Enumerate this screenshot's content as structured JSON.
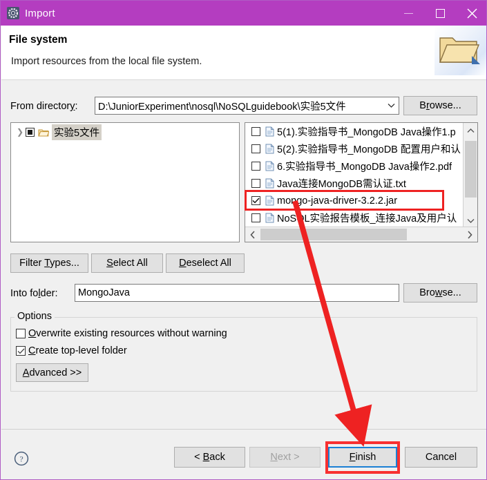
{
  "window": {
    "title": "Import",
    "icon": "gear-icon",
    "accent_color": "#b43dc0",
    "minimize_label": "Minimize",
    "maximize_label": "Maximize",
    "close_label": "Close"
  },
  "header": {
    "title": "File system",
    "description": "Import resources from the local file system.",
    "banner_icon": "open-folder-icon"
  },
  "from_directory": {
    "label": "From directory:",
    "value": "D:\\JuniorExperiment\\nosql\\NoSQLguidebook\\实验5文件",
    "dropdown_icon": "chevron-down-icon",
    "browse_label": "Browse..."
  },
  "tree": {
    "node_label": "实验5文件",
    "expand_icon": "chevron-right-icon",
    "folder_icon": "open-folder-icon",
    "check_state": "partial"
  },
  "file_list": {
    "items": [
      {
        "name": "5(1).实验指导书_MongoDB Java操作1.p",
        "checked": false,
        "icon": "file-icon"
      },
      {
        "name": "5(2).实验指导书_MongoDB 配置用户和认",
        "checked": false,
        "icon": "file-icon"
      },
      {
        "name": "6.实验指导书_MongoDB Java操作2.pdf",
        "checked": false,
        "icon": "file-icon"
      },
      {
        "name": "Java连接MongoDB需认证.txt",
        "checked": false,
        "icon": "file-icon"
      },
      {
        "name": "mongo-java-driver-3.2.2.jar",
        "checked": true,
        "icon": "file-icon"
      },
      {
        "name": "NoSQL实验报告模板_连接Java及用户认",
        "checked": false,
        "icon": "file-icon"
      }
    ],
    "scroll_up_icon": "chevron-up-icon",
    "scroll_down_icon": "chevron-down-icon",
    "scroll_left_icon": "chevron-left-icon",
    "scroll_right_icon": "chevron-right-icon"
  },
  "list_buttons": {
    "filter_types": "Filter Types...",
    "select_all": "Select All",
    "deselect_all": "Deselect All"
  },
  "into_folder": {
    "label": "Into folder:",
    "value": "MongoJava",
    "browse_label": "Browse..."
  },
  "options": {
    "legend": "Options",
    "overwrite": {
      "label": "Overwrite existing resources without warning",
      "checked": false
    },
    "create_top_level": {
      "label": "Create top-level folder",
      "checked": true
    },
    "advanced_label": "Advanced >>"
  },
  "footer": {
    "help_icon": "question-mark-icon",
    "back": "< Back",
    "next": "Next >",
    "next_disabled": true,
    "finish": "Finish",
    "cancel": "Cancel"
  },
  "annotations": {
    "highlight_color": "#ee2222",
    "arrow_from": "mongo-java-driver-3.2.2.jar row",
    "arrow_to": "Finish button"
  }
}
